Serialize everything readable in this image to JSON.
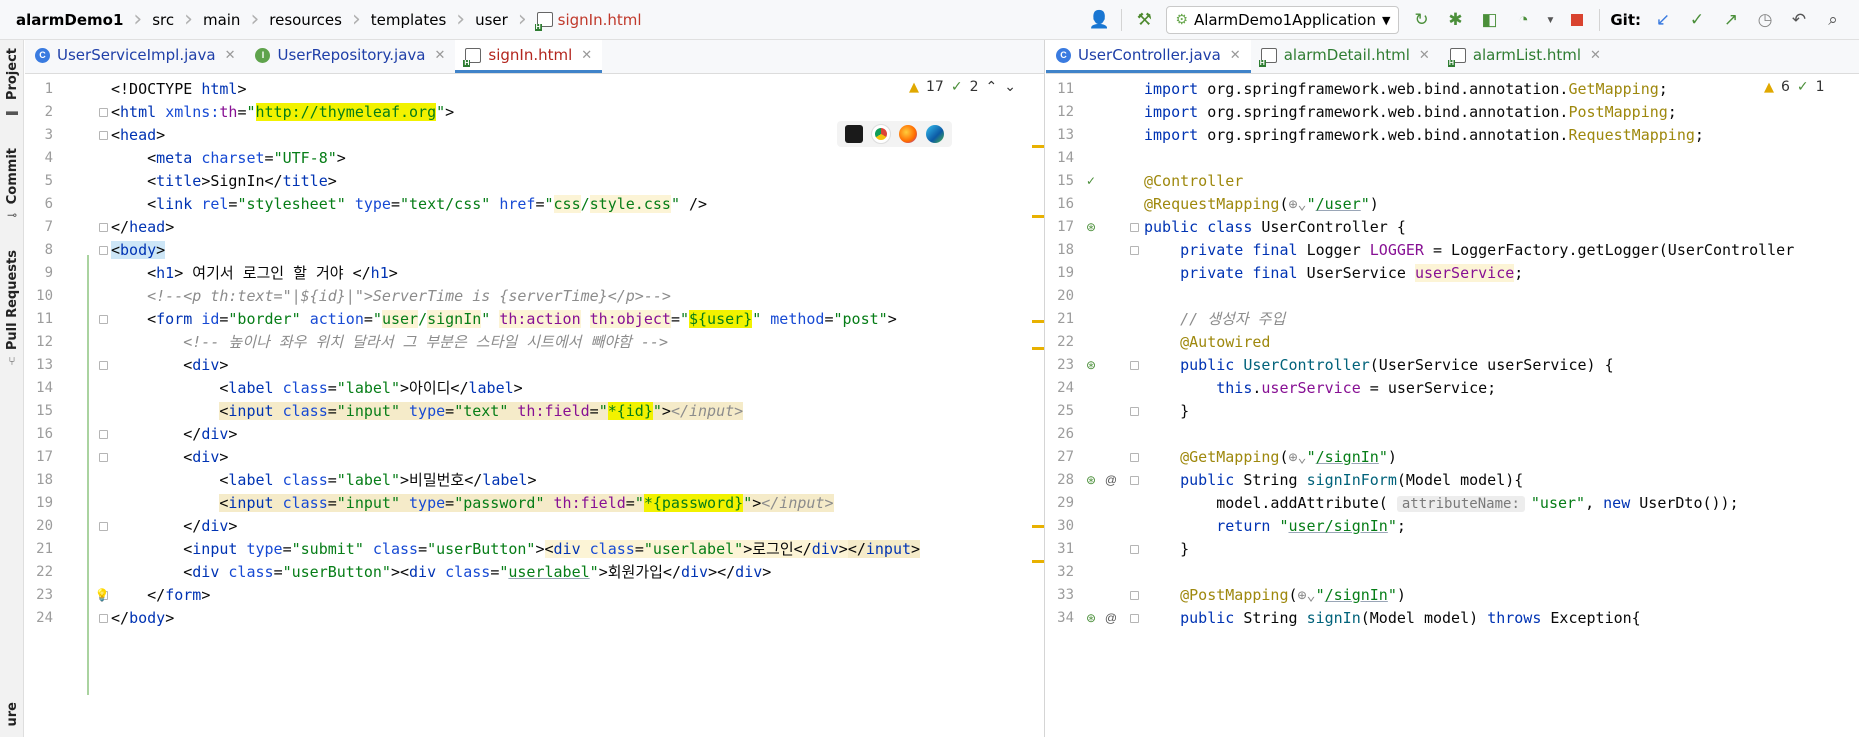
{
  "breadcrumbs": [
    "alarmDemo1",
    "src",
    "main",
    "resources",
    "templates",
    "user",
    "signIn.html"
  ],
  "toolbar": {
    "run_config": "AlarmDemo1Application",
    "git_label": "Git:"
  },
  "tool_windows": {
    "project": "Project",
    "commit": "Commit",
    "pull_requests": "Pull Requests",
    "structure": "ure"
  },
  "left_editor": {
    "tabs": [
      {
        "label": "UserServiceImpl.java",
        "icon": "class-icon",
        "active": false
      },
      {
        "label": "UserRepository.java",
        "icon": "interface-icon",
        "active": false
      },
      {
        "label": "signIn.html",
        "icon": "html-file-icon",
        "active": true
      }
    ],
    "inspection": {
      "warnings": "17",
      "weak_warnings": "2"
    },
    "line_numbers": [
      "1",
      "2",
      "3",
      "4",
      "5",
      "6",
      "7",
      "8",
      "9",
      "10",
      "11",
      "12",
      "13",
      "14",
      "15",
      "16",
      "17",
      "18",
      "19",
      "20",
      "21",
      "22",
      "23",
      "24"
    ]
  },
  "right_editor": {
    "tabs": [
      {
        "label": "UserController.java",
        "icon": "class-icon",
        "active": true
      },
      {
        "label": "alarmDetail.html",
        "icon": "html-file-icon",
        "active": false
      },
      {
        "label": "alarmList.html",
        "icon": "html-file-icon",
        "active": false
      }
    ],
    "inspection": {
      "warnings": "6",
      "weak_warnings": "1"
    },
    "line_numbers": [
      "11",
      "12",
      "13",
      "14",
      "15",
      "16",
      "17",
      "18",
      "19",
      "20",
      "21",
      "22",
      "23",
      "24",
      "25",
      "26",
      "27",
      "28",
      "29",
      "30",
      "31",
      "32",
      "33",
      "34"
    ]
  },
  "colors": {
    "tag": "#0033b3",
    "attr": "#174ad4",
    "string": "#067d17",
    "thymeleaf": "#871094",
    "comment": "#8c8c8c",
    "annotation": "#9e880d",
    "highlight": "#f2f200",
    "active_tab": "#b3261e"
  }
}
